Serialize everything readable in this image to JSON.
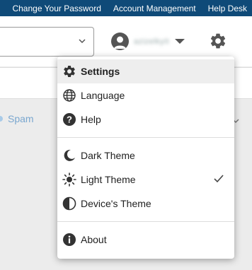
{
  "topbar": {
    "links": [
      "Change Your Password",
      "Account Management",
      "Help Desk"
    ]
  },
  "header": {
    "user_name": "azizelkyIt"
  },
  "background": {
    "folder_label": "Spam"
  },
  "menu": {
    "items": [
      {
        "label": "Settings",
        "icon": "gear-icon",
        "selected": true
      },
      {
        "label": "Language",
        "icon": "globe-icon"
      },
      {
        "label": "Help",
        "icon": "help-icon"
      },
      {
        "label": "Dark Theme",
        "icon": "moon-icon"
      },
      {
        "label": "Light Theme",
        "icon": "sun-icon",
        "checked": true
      },
      {
        "label": "Device's Theme",
        "icon": "half-circle-icon"
      },
      {
        "label": "About",
        "icon": "info-icon"
      }
    ]
  },
  "colors": {
    "topbar": "#0f4a78",
    "menu_active": "#eeeeee",
    "spam_text": "#7aa7cf"
  }
}
